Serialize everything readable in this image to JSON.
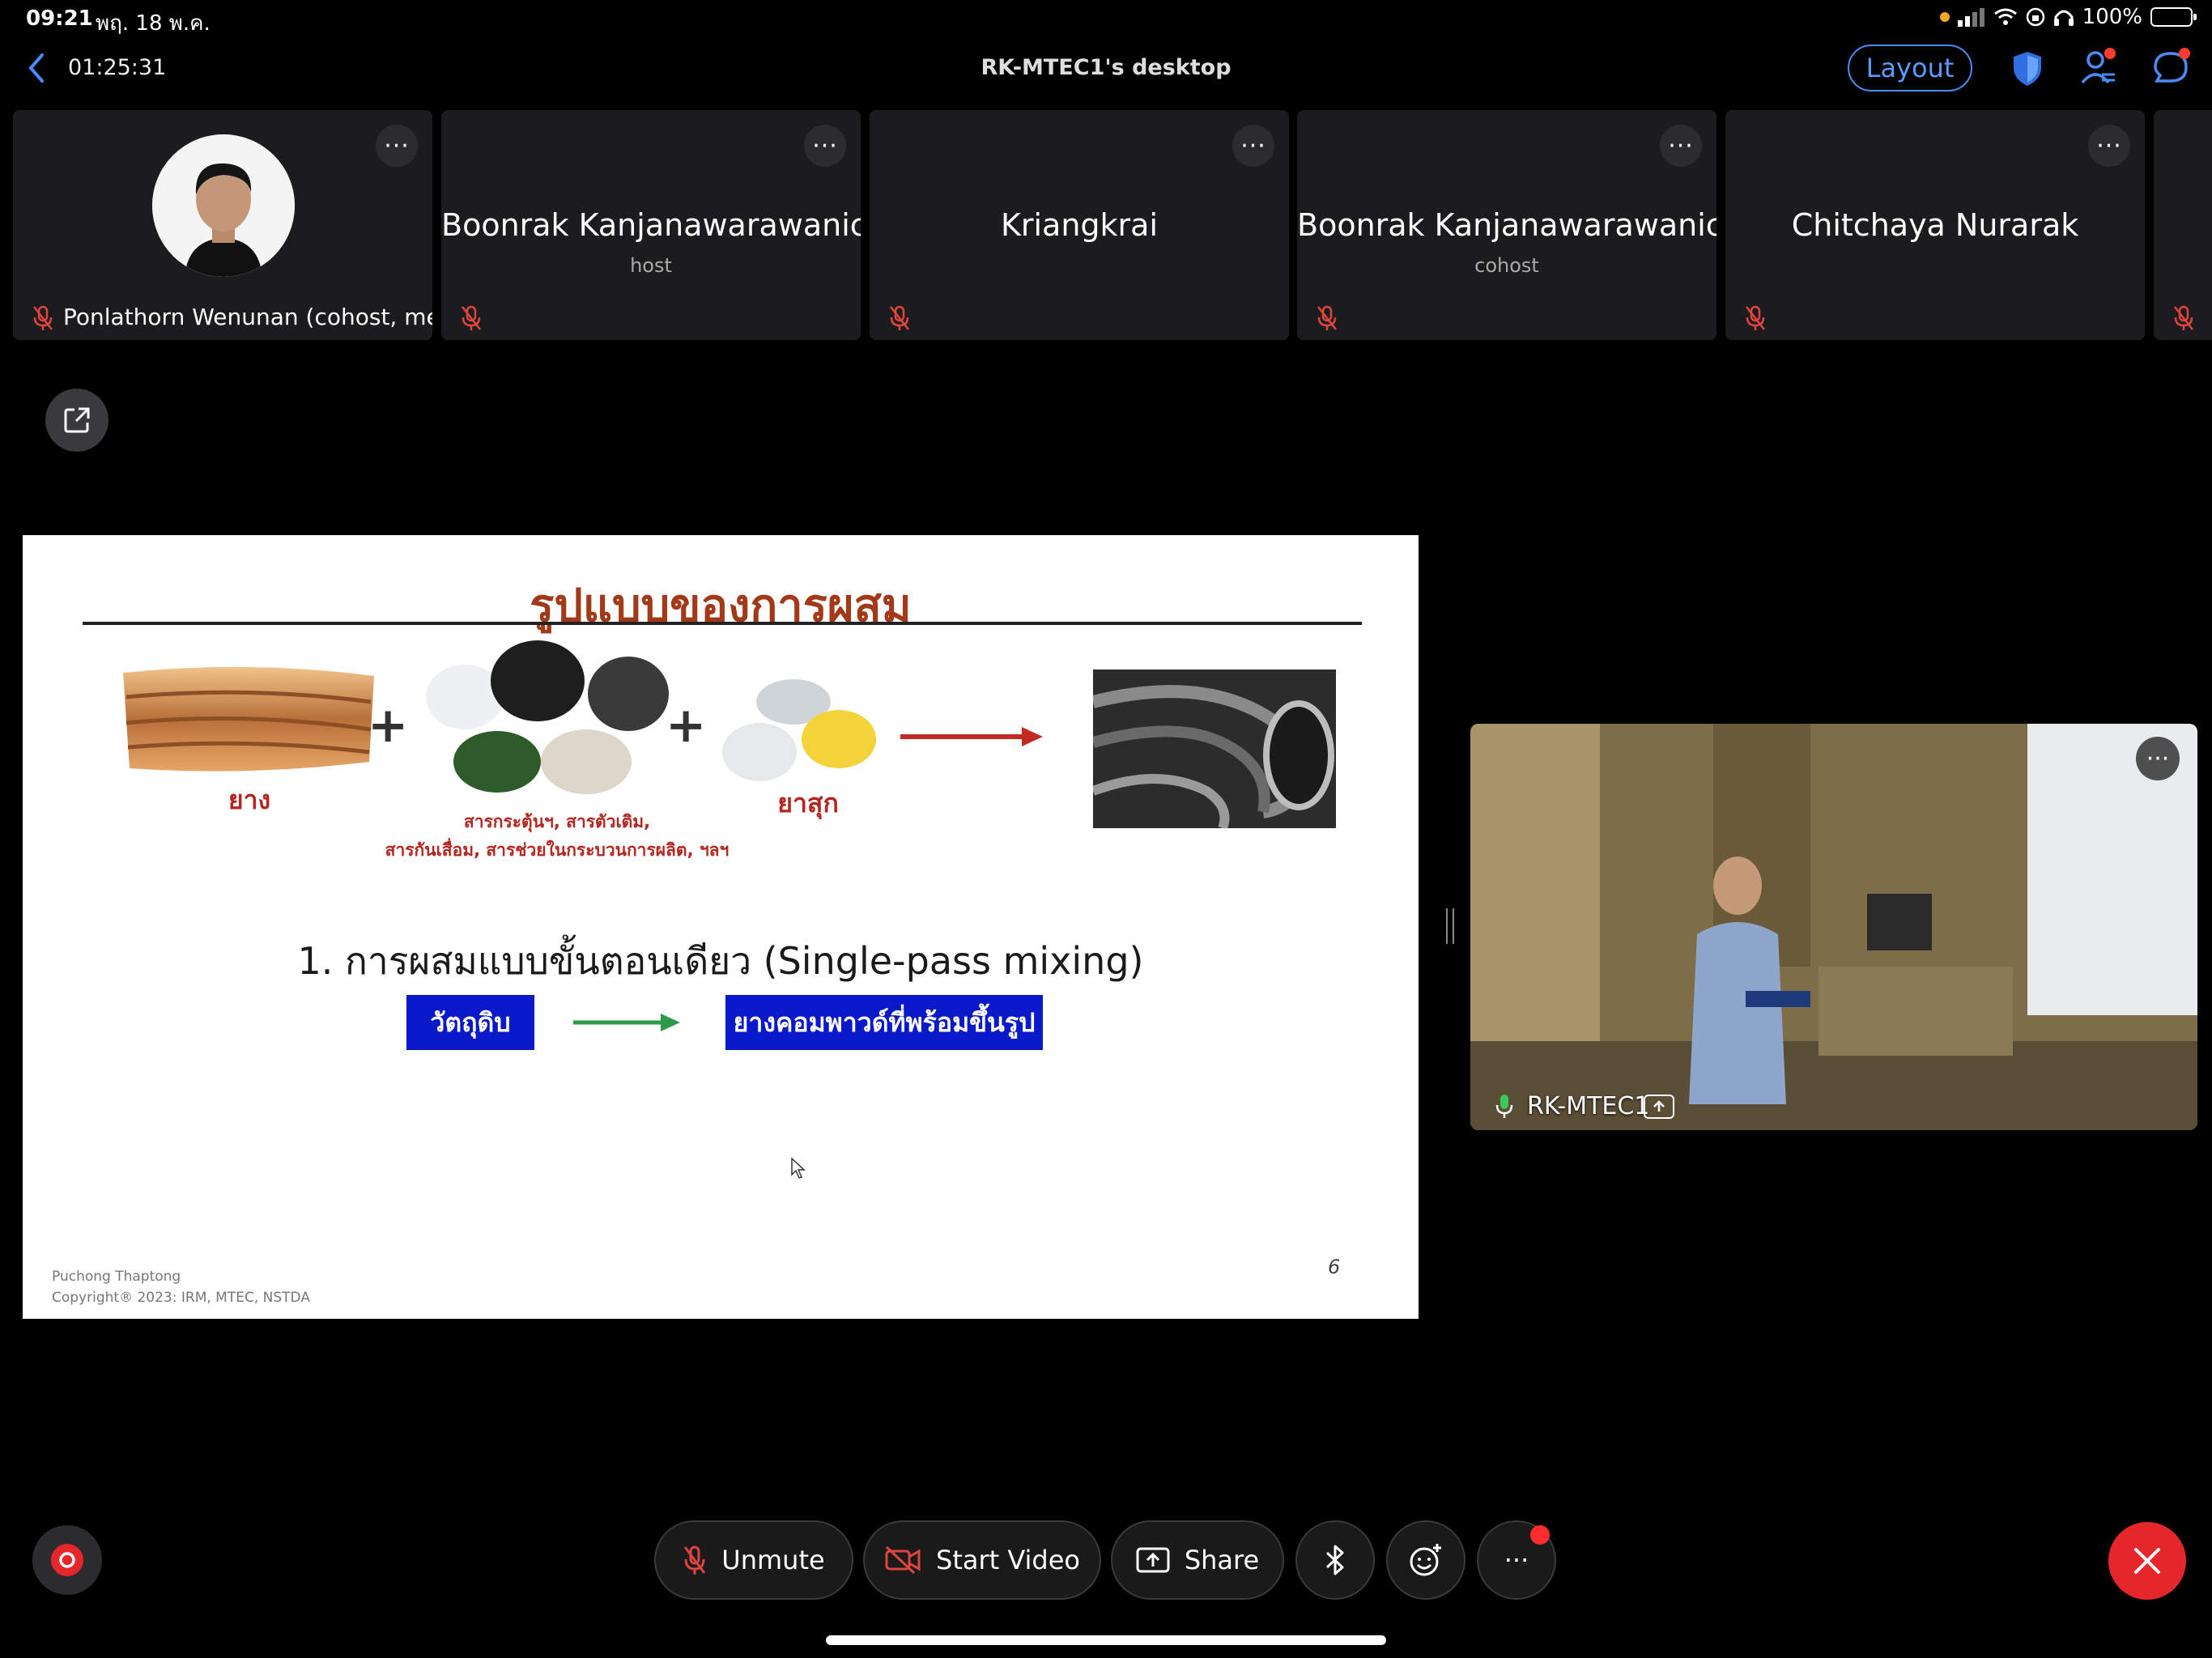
{
  "status_bar": {
    "time": "09:21",
    "date": "พฤ. 18 พ.ค.",
    "battery": "100%"
  },
  "header": {
    "elapsed": "01:25:31",
    "title": "RK-MTEC1's desktop",
    "layout_label": "Layout"
  },
  "participants": [
    {
      "name": "Ponlathorn Wenunan (cohost, me)",
      "role": ""
    },
    {
      "name": "Boonrak Kanjanawarawanich",
      "role": "host"
    },
    {
      "name": "Kriangkrai",
      "role": ""
    },
    {
      "name": "Boonrak Kanjanawarawanich",
      "role": "cohost"
    },
    {
      "name": "Chitchaya Nurarak",
      "role": ""
    }
  ],
  "slide": {
    "title": "รูปแบบของการผสม",
    "label_rubber": "ยาง",
    "label_additives_line1": "สารกระตุ้นฯ, สารตัวเติม,",
    "label_additives_line2": "สารกันเสื่อม, สารช่วยในกระบวนการผลิต, ฯลฯ",
    "label_cure": "ยาสุก",
    "plus": "+",
    "step_heading": "1. การผสมแบบขั้นตอนเดียว (Single-pass mixing)",
    "box_raw": "วัตถุดิบ",
    "box_compound": "ยางคอมพาวด์ที่พร้อมขึ้นรูป",
    "author": "Puchong Thaptong",
    "copyright": "Copyright® 2023: IRM, MTEC, NSTDA",
    "page_number": "6"
  },
  "video": {
    "name": "RK-MTEC1"
  },
  "controls": {
    "unmute": "Unmute",
    "start_video": "Start Video",
    "share": "Share",
    "more": "···"
  },
  "colors": {
    "accent": "#4a8cf7",
    "end_call": "#e5272b",
    "muted_mic": "#e0443e",
    "slide_title": "#a23a1a",
    "slide_box": "#0a19c9"
  }
}
